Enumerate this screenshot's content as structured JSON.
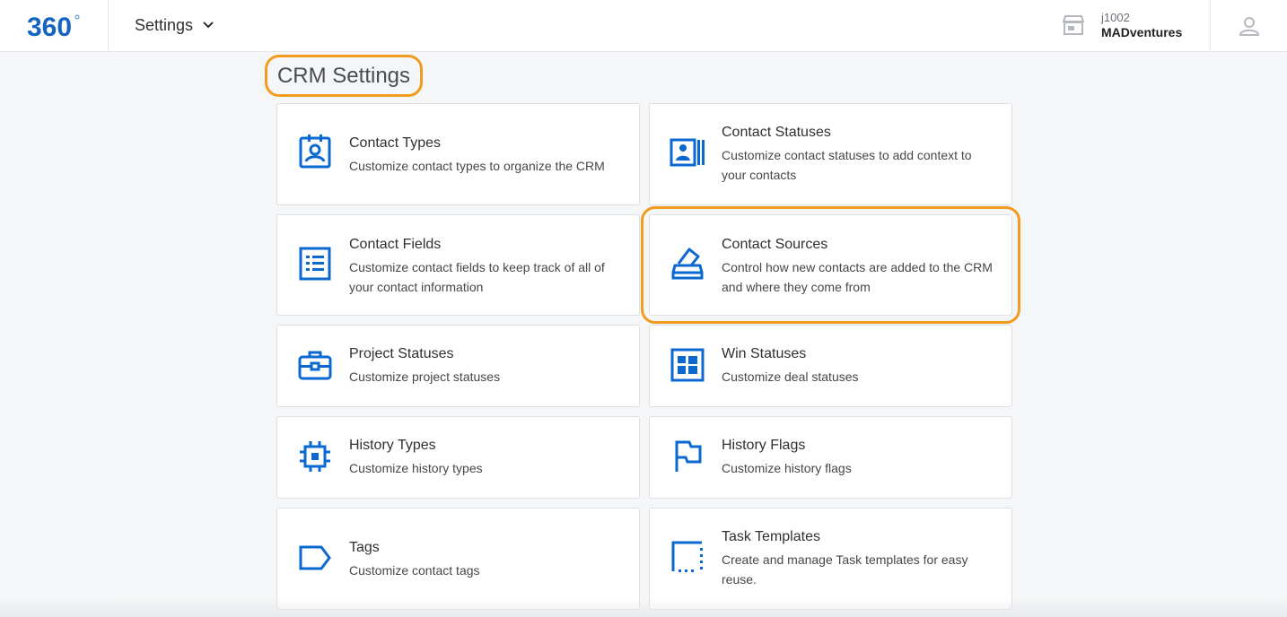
{
  "header": {
    "logo_text": "360",
    "nav_title": "Settings",
    "account_id": "j1002",
    "account_name": "MADventures"
  },
  "page": {
    "title": "CRM Settings"
  },
  "cards": [
    {
      "title": "Contact Types",
      "desc": "Customize contact types to organize the CRM",
      "icon": "contact-badge-icon"
    },
    {
      "title": "Contact Statuses",
      "desc": "Customize contact statuses to add context to your contacts",
      "icon": "contact-card-status-icon"
    },
    {
      "title": "Contact Fields",
      "desc": "Customize contact fields to keep track of all of your contact information",
      "icon": "list-form-icon"
    },
    {
      "title": "Contact Sources",
      "desc": "Control how new contacts are added to the CRM and where they come from",
      "icon": "ballot-box-icon"
    },
    {
      "title": "Project Statuses",
      "desc": "Customize project statuses",
      "icon": "briefcase-icon"
    },
    {
      "title": "Win Statuses",
      "desc": "Customize deal statuses",
      "icon": "dashboard-grid-icon"
    },
    {
      "title": "History Types",
      "desc": "Customize history types",
      "icon": "chip-icon"
    },
    {
      "title": "History Flags",
      "desc": "Customize history flags",
      "icon": "flag-icon"
    },
    {
      "title": "Tags",
      "desc": "Customize contact tags",
      "icon": "tag-icon"
    },
    {
      "title": "Task Templates",
      "desc": "Create and manage Task templates for easy reuse.",
      "icon": "template-icon"
    }
  ],
  "colors": {
    "accent_blue": "#0b68d0",
    "highlight_orange": "#f29b1d"
  }
}
